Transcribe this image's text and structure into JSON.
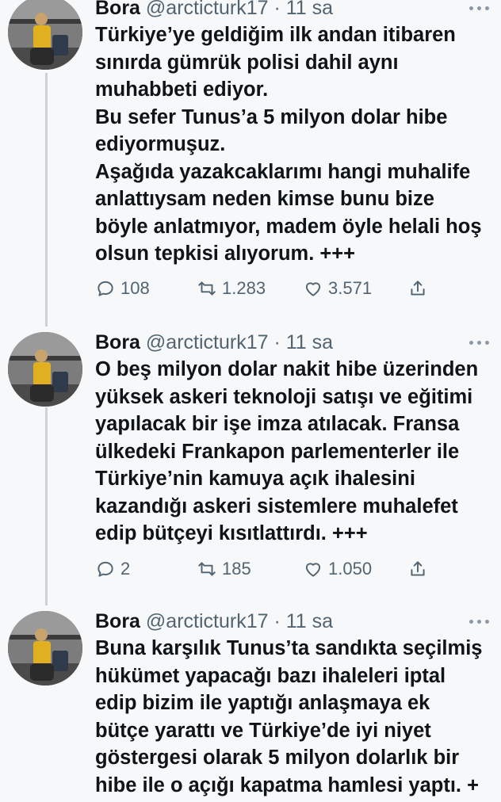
{
  "tweets": [
    {
      "author": "Bora",
      "handle": "@arcticturk17",
      "separator": "·",
      "time": "11 sa",
      "text_lines": [
        "Türkiye’ye geldiğim ilk andan itibaren",
        "sınırda gümrük polisi dahil aynı",
        "muhabbeti ediyor.",
        "Bu sefer Tunus’a 5 milyon dolar hibe",
        "ediyormuşuz.",
        "Aşağıda yazakcaklarımı hangi muhalife",
        "anlattıysam neden kimse bunu bize",
        "böyle anlatmıyor, madem öyle helali hoş",
        "olsun tepkisi alıyorum. +++"
      ],
      "replies": "108",
      "retweets": "1.283",
      "likes": "3.571"
    },
    {
      "author": "Bora",
      "handle": "@arcticturk17",
      "separator": "·",
      "time": "11 sa",
      "text_lines": [
        "O beş milyon dolar nakit hibe üzerinden",
        "yüksek askeri teknoloji satışı ve eğitimi",
        "yapılacak bir işe imza atılacak. Fransa",
        "ülkedeki Frankapon parlementerler ile",
        "Türkiye’nin kamuya açık ihalesini",
        "kazandığı askeri sistemlere muhalefet",
        "edip bütçeyi kısıtlattırdı. +++"
      ],
      "replies": "2",
      "retweets": "185",
      "likes": "1.050"
    },
    {
      "author": "Bora",
      "handle": "@arcticturk17",
      "separator": "·",
      "time": "11 sa",
      "text_lines": [
        "Buna karşılık Tunus’ta sandıkta seçilmiş",
        "hükümet yapacağı bazı ihaleleri iptal",
        "edip bizim ile yaptığı anlaşmaya ek",
        "bütçe yarattı ve Türkiye’de iyi niyet",
        "göstergesi olarak 5 milyon dolarlık bir",
        "hibe ile o açığı kapatma hamlesi yaptı. +"
      ]
    }
  ],
  "icons": {
    "reply": "reply-icon",
    "retweet": "retweet-icon",
    "like": "heart-icon",
    "share": "share-icon",
    "more": "more-icon"
  },
  "colors": {
    "background": "#f6f8fa",
    "text": "#0f1419",
    "secondary": "#536471",
    "thread_line": "#c9d1d9"
  }
}
